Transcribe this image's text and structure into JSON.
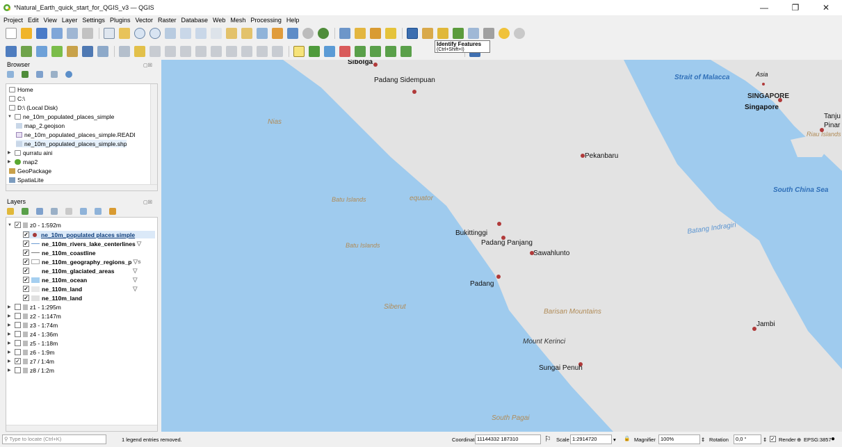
{
  "window": {
    "title": "*Natural_Earth_quick_start_for_QGIS_v3 — QGIS",
    "minimize": "—",
    "maximize": "❐",
    "close": "✕"
  },
  "menu": [
    "Project",
    "Edit",
    "View",
    "Layer",
    "Settings",
    "Plugins",
    "Vector",
    "Raster",
    "Database",
    "Web",
    "Mesh",
    "Processing",
    "Help"
  ],
  "tooltip": {
    "title": "Identify Features",
    "shortcut": "(Ctrl+Shift+I)"
  },
  "browser": {
    "title": "Browser",
    "items": [
      {
        "label": "Home",
        "icon": "home-folder-icon"
      },
      {
        "label": "C:\\",
        "icon": "drive-icon"
      },
      {
        "label": "D:\\ (Local Disk)",
        "icon": "drive-icon"
      },
      {
        "label": "ne_10m_populated_places_simple",
        "icon": "folder-icon"
      },
      {
        "label": "map_2.geojson",
        "icon": "vector-file-icon"
      },
      {
        "label": "ne_10m_populated_places_simple.READI",
        "icon": "html-file-icon"
      },
      {
        "label": "ne_10m_populated_places_simple.shp",
        "icon": "vector-file-icon"
      },
      {
        "label": "qurratu aini",
        "icon": "folder-icon"
      },
      {
        "label": "map2",
        "icon": "qgis-project-icon"
      },
      {
        "label": "GeoPackage",
        "icon": "geopackage-icon"
      },
      {
        "label": "SpatiaLite",
        "icon": "spatialite-icon"
      }
    ]
  },
  "layers": {
    "title": "Layers",
    "groups": [
      {
        "label": "z0 - 1:592m",
        "checked": true
      },
      {
        "label": "z1 - 1:295m",
        "checked": false
      },
      {
        "label": "z2 - 1:147m",
        "checked": false
      },
      {
        "label": "z3 - 1:74m",
        "checked": false
      },
      {
        "label": "z4 - 1:36m",
        "checked": false
      },
      {
        "label": "z5 - 1:18m",
        "checked": false
      },
      {
        "label": "z6 - 1:9m",
        "checked": false
      },
      {
        "label": "z7 / 1:4m",
        "checked": true
      },
      {
        "label": "z8 / 1:2m",
        "checked": false
      }
    ],
    "z0_layers": [
      {
        "label": "ne_10m_populated places simple",
        "checked": true,
        "symbol": "point",
        "color": "#a43a3a"
      },
      {
        "label": "ne_110m_rivers_lake_centerlines",
        "checked": true,
        "symbol": "line",
        "color": "#6c9bd2"
      },
      {
        "label": "ne_110m_coastline",
        "checked": true,
        "symbol": "line",
        "color": "#7a7a7a"
      },
      {
        "label": "ne_110m_geography_regions_p",
        "checked": true,
        "symbol": "poly-outline",
        "color": "#cccccc"
      },
      {
        "label": "ne_110m_glaciated_areas",
        "checked": true,
        "symbol": "fill",
        "color": "#ffffff"
      },
      {
        "label": "ne_110m_ocean",
        "checked": true,
        "symbol": "fill",
        "color": "#a5cff0"
      },
      {
        "label": "ne_110m_land",
        "checked": true,
        "symbol": "fill",
        "color": "#e8e8e8"
      },
      {
        "label": "ne_110m_land",
        "checked": true,
        "symbol": "fill",
        "color": "#e0e0e0"
      }
    ]
  },
  "map": {
    "colors": {
      "ocean": "#9fcbee",
      "land": "#e3e3e3",
      "city": "#b03a3a",
      "water_label": "#2f6fb8",
      "region_label": "#b08b57"
    },
    "cities": [
      "Sibolga",
      "Padang Sidempuan",
      "Pekanbaru",
      "Bukittinggi",
      "Padang Panjang",
      "Sawahlunto",
      "Padang",
      "Sungai Penuh",
      "Jambi",
      "Asia",
      "SINGAPORE",
      "Singapore",
      "Tanju",
      "Pinar"
    ],
    "labels": {
      "nias": "Nias",
      "batu1": "Batu Islands",
      "batu2": "Batu Islands",
      "equator": "equator",
      "siberut": "Siberut",
      "barisan": "Barisan Mountains",
      "kerinci": "Mount Kerinci",
      "south_pagai": "South Pagai",
      "malacca": "Strait of Malacca",
      "riau": "Riau Islands",
      "scs": "South China Sea",
      "indragiri": "Batang Indragiri"
    }
  },
  "status": {
    "locate_placeholder": "Type to locate (Ctrl+K)",
    "message": "1 legend entries removed.",
    "coordinate_label": "Coordinate",
    "coordinate_value": "11144332 187310",
    "scale_label": "Scale",
    "scale_value": "1:2914720",
    "magnifier_label": "Magnifier",
    "magnifier_value": "100%",
    "rotation_label": "Rotation",
    "rotation_value": "0,0 °",
    "render_label": "Render",
    "crs": "EPSG:3857"
  }
}
